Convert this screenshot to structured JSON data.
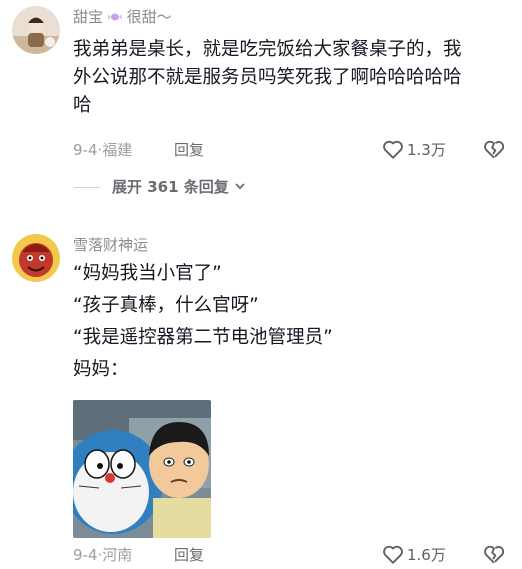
{
  "comments": [
    {
      "username": "甜宝",
      "username_suffix": "很甜～",
      "text_lines": [
        "我弟弟是桌长，就是吃完饭给大家餐桌子的，我",
        "外公说那不就是服务员吗笑死我了啊哈哈哈哈哈",
        "哈"
      ],
      "date": "9-4",
      "location": "福建",
      "reply_label": "回复",
      "like_count": "1.3万",
      "expand_label": "展开 361 条回复"
    },
    {
      "username": "雪落财神运",
      "text_lines": [
        "“妈妈我当小官了”",
        "“孩子真棒，什么官呀”",
        "“我是遥控器第二节电池管理员”",
        "妈妈："
      ],
      "date": "9-4",
      "location": "河南",
      "reply_label": "回复",
      "like_count": "1.6万"
    }
  ],
  "colors": {
    "primary_text": "#161823",
    "secondary_text": "#8a8b91",
    "icon": "#5d5e64"
  }
}
